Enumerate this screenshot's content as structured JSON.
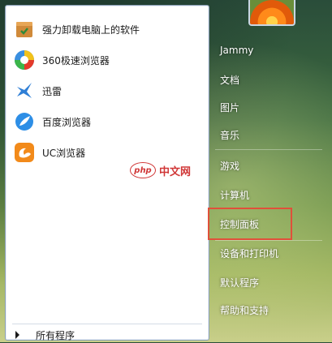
{
  "programs": [
    {
      "label": "强力卸载电脑上的软件",
      "icon": "uninstaller-icon"
    },
    {
      "label": "360极速浏览器",
      "icon": "360-browser-icon"
    },
    {
      "label": "迅雷",
      "icon": "xunlei-icon"
    },
    {
      "label": "百度浏览器",
      "icon": "baidu-browser-icon"
    },
    {
      "label": "UC浏览器",
      "icon": "uc-browser-icon"
    }
  ],
  "all_programs_label": "所有程序",
  "watermark": {
    "logo": "php",
    "text": "中文网"
  },
  "right_menu": [
    {
      "label": "Jammy"
    },
    {
      "label": "文档"
    },
    {
      "label": "图片"
    },
    {
      "label": "音乐"
    },
    {
      "label": "游戏"
    },
    {
      "label": "计算机"
    },
    {
      "label": "控制面板"
    },
    {
      "label": "设备和打印机"
    },
    {
      "label": "默认程序"
    },
    {
      "label": "帮助和支持"
    }
  ],
  "highlighted_item": "控制面板",
  "colors": {
    "highlight": "#e0503a",
    "watermark": "#cc2222"
  }
}
